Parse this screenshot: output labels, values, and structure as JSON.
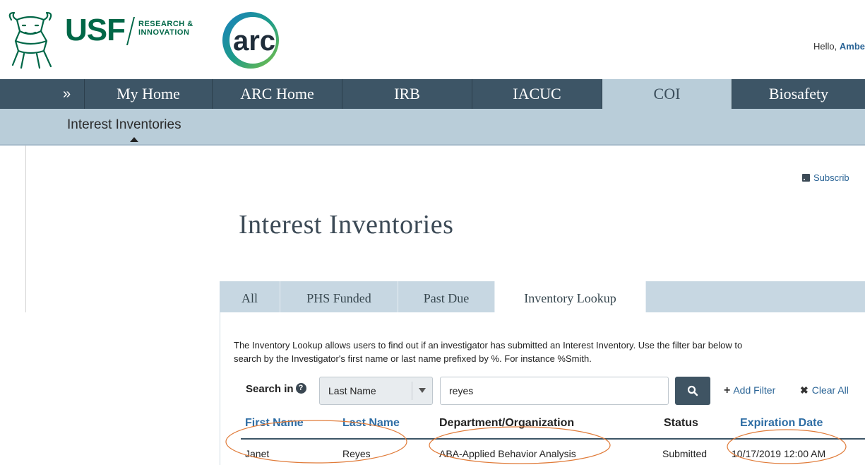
{
  "header": {
    "usf_wordmark": "USF",
    "usf_subline_1": "RESEARCH &",
    "usf_subline_2": "INNOVATION",
    "arc_logo_text": "arc",
    "greeting": "Hello,",
    "user_name": "Ambe"
  },
  "nav": {
    "expand_glyph": "»",
    "items": [
      {
        "label": "My Home"
      },
      {
        "label": "ARC Home"
      },
      {
        "label": "IRB"
      },
      {
        "label": "IACUC"
      },
      {
        "label": "COI",
        "active": true
      },
      {
        "label": "Biosafety"
      }
    ]
  },
  "subnav": {
    "items": [
      {
        "label": "Interest Inventories",
        "active": true
      }
    ]
  },
  "subscribe_label": "Subscrib",
  "page_title": "Interest Inventories",
  "tabs": [
    {
      "label": "All"
    },
    {
      "label": "PHS Funded"
    },
    {
      "label": "Past Due"
    },
    {
      "label": "Inventory Lookup",
      "active": true
    }
  ],
  "description": {
    "line1": "The Inventory Lookup allows users to find out if an investigator has submitted an Interest Inventory. Use the filter bar below to",
    "line2": "search by the Investigator's first name or last name prefixed by %. For instance %Smith."
  },
  "filter": {
    "search_in_label": "Search in",
    "help_glyph": "?",
    "field_selected": "Last Name",
    "query_value": "reyes",
    "add_filter_label": "Add Filter",
    "clear_all_label": "Clear All"
  },
  "table": {
    "columns": [
      {
        "label": "First Name",
        "sortable": true
      },
      {
        "label": "Last Name",
        "sortable": true
      },
      {
        "label": "Department/Organization",
        "sortable": false
      },
      {
        "label": "Status",
        "sortable": false
      },
      {
        "label": "Expiration Date",
        "sortable": true
      }
    ],
    "rows": [
      {
        "first_name": "Janet",
        "last_name": "Reyes",
        "department": "ABA-Applied Behavior Analysis",
        "status": "Submitted",
        "expiration": "10/17/2019 12:00 AM"
      }
    ]
  },
  "colors": {
    "nav_bg": "#3d5566",
    "subnav_bg": "#b9cdd9",
    "usf_green": "#006747",
    "link_blue": "#2e6da4",
    "annotation_orange": "#e07b39"
  }
}
